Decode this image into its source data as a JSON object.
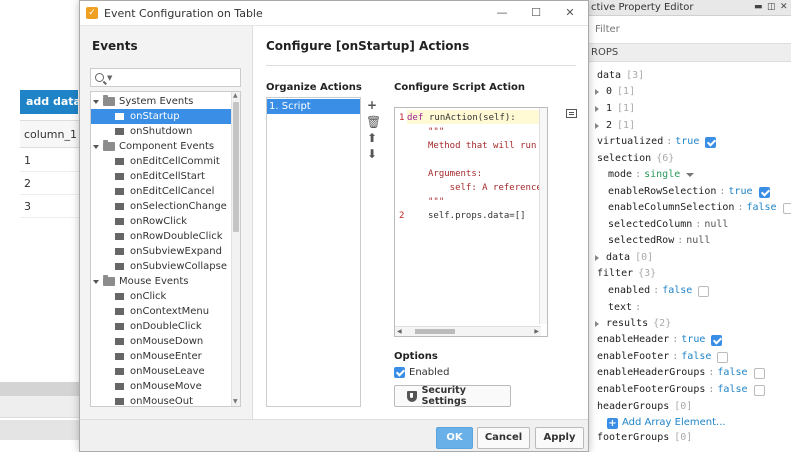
{
  "background": {
    "add_data_label": "add data",
    "table_header": "column_1",
    "rows": [
      "1",
      "2",
      "3"
    ]
  },
  "property_editor": {
    "title": "ctive Property Editor",
    "filter_placeholder": "Filter",
    "section": "ROPS",
    "rows": [
      {
        "key": "data",
        "count": "[3]"
      },
      {
        "key": "0",
        "count": "[1]"
      },
      {
        "key": "1",
        "count": "[1]"
      },
      {
        "key": "2",
        "count": "[1]"
      },
      {
        "key": "virtualized",
        "value": "true"
      },
      {
        "key": "selection",
        "count": "{6}"
      },
      {
        "key": "mode",
        "value": "single"
      },
      {
        "key": "enableRowSelection",
        "value": "true"
      },
      {
        "key": "enableColumnSelection",
        "value": "false"
      },
      {
        "key": "selectedColumn",
        "value": "null"
      },
      {
        "key": "selectedRow",
        "value": "null"
      },
      {
        "key": "data",
        "count": "[0]"
      },
      {
        "key": "filter",
        "count": "{3}"
      },
      {
        "key": "enabled",
        "value": "false"
      },
      {
        "key": "text",
        "value": ""
      },
      {
        "key": "results",
        "count": "{2}"
      },
      {
        "key": "enableHeader",
        "value": "true"
      },
      {
        "key": "enableFooter",
        "value": "false"
      },
      {
        "key": "enableHeaderGroups",
        "value": "false"
      },
      {
        "key": "enableFooterGroups",
        "value": "false"
      },
      {
        "key": "headerGroups",
        "count": "[0]"
      },
      {
        "key": "footerGroups",
        "count": "[0]"
      }
    ],
    "add_array_element": "Add Array Element...",
    "separator": ":"
  },
  "dialog": {
    "title": "Event Configuration on Table",
    "events_heading": "Events",
    "config_heading": "Configure [onStartup] Actions",
    "organize_heading": "Organize Actions",
    "script_heading": "Configure Script Action",
    "actions": [
      "1. Script"
    ],
    "tree": [
      {
        "label": "System Events",
        "type": "group"
      },
      {
        "label": "onStartup",
        "type": "event",
        "selected": true
      },
      {
        "label": "onShutdown",
        "type": "event"
      },
      {
        "label": "Component Events",
        "type": "group"
      },
      {
        "label": "onEditCellCommit",
        "type": "event"
      },
      {
        "label": "onEditCellStart",
        "type": "event"
      },
      {
        "label": "onEditCellCancel",
        "type": "event"
      },
      {
        "label": "onSelectionChange",
        "type": "event"
      },
      {
        "label": "onRowClick",
        "type": "event"
      },
      {
        "label": "onRowDoubleClick",
        "type": "event"
      },
      {
        "label": "onSubviewExpand",
        "type": "event"
      },
      {
        "label": "onSubviewCollapse",
        "type": "event"
      },
      {
        "label": "Mouse Events",
        "type": "group"
      },
      {
        "label": "onClick",
        "type": "event"
      },
      {
        "label": "onContextMenu",
        "type": "event"
      },
      {
        "label": "onDoubleClick",
        "type": "event"
      },
      {
        "label": "onMouseDown",
        "type": "event"
      },
      {
        "label": "onMouseEnter",
        "type": "event"
      },
      {
        "label": "onMouseLeave",
        "type": "event"
      },
      {
        "label": "onMouseMove",
        "type": "event"
      },
      {
        "label": "onMouseOut",
        "type": "event"
      }
    ],
    "code": {
      "line1_kw": "def",
      "line1_rest": "runAction(self):",
      "doc_open": "\"\"\"",
      "doc_text1": "Method that will run w",
      "doc_args": "Arguments:",
      "doc_self": "    self: A reference",
      "doc_close": "\"\"\"",
      "line2": "self.props.data=[]",
      "line_numbers": [
        "1",
        "2"
      ]
    },
    "options_heading": "Options",
    "enabled_label": "Enabled",
    "security_label": "Security Settings",
    "ok_label": "OK",
    "cancel_label": "Cancel",
    "apply_label": "Apply"
  }
}
